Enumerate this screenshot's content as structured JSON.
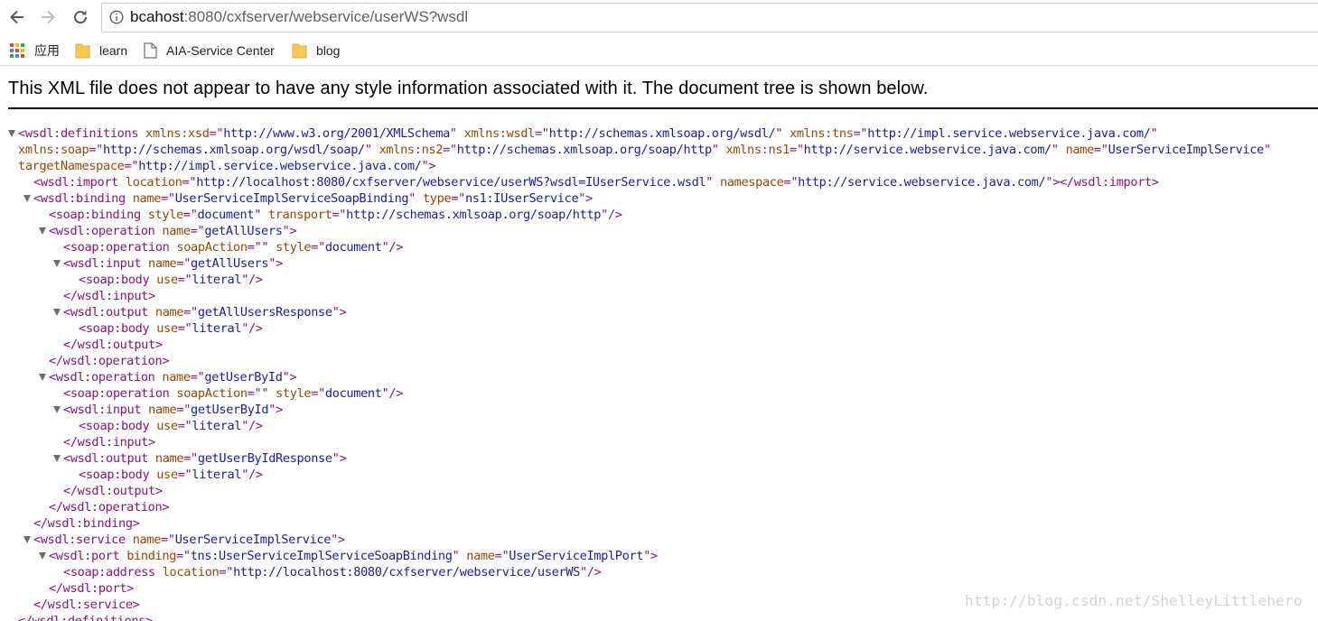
{
  "browser": {
    "url_host": "bcahost",
    "url_rest": ":8080/cxfserver/webservice/userWS?wsdl",
    "bookmarks": [
      {
        "label": "应用",
        "icon": "apps-grid-icon"
      },
      {
        "label": "learn",
        "icon": "folder-icon"
      },
      {
        "label": "AIA-Service Center",
        "icon": "page-icon"
      },
      {
        "label": "blog",
        "icon": "folder-icon"
      }
    ]
  },
  "page": {
    "notice": "This XML file does not appear to have any style information associated with it. The document tree is shown below."
  },
  "xml_lines": [
    {
      "indent": 20,
      "collapsible": true,
      "segs": [
        [
          "tg",
          "<wsdl:definitions"
        ],
        [
          "t",
          " "
        ],
        [
          "an",
          "xmlns:xsd"
        ],
        [
          "tg",
          "=\""
        ],
        [
          "av",
          "http://www.w3.org/2001/XMLSchema"
        ],
        [
          "tg",
          "\""
        ],
        [
          "t",
          " "
        ],
        [
          "an",
          "xmlns:wsdl"
        ],
        [
          "tg",
          "=\""
        ],
        [
          "av",
          "http://schemas.xmlsoap.org/wsdl/"
        ],
        [
          "tg",
          "\""
        ],
        [
          "t",
          " "
        ],
        [
          "an",
          "xmlns:tns"
        ],
        [
          "tg",
          "=\""
        ],
        [
          "av",
          "http://impl.service.webservice.java.com/"
        ],
        [
          "tg",
          "\""
        ]
      ]
    },
    {
      "indent": 20,
      "collapsible": false,
      "segs": [
        [
          "an",
          "xmlns:soap"
        ],
        [
          "tg",
          "=\""
        ],
        [
          "av",
          "http://schemas.xmlsoap.org/wsdl/soap/"
        ],
        [
          "tg",
          "\""
        ],
        [
          "t",
          " "
        ],
        [
          "an",
          "xmlns:ns2"
        ],
        [
          "tg",
          "=\""
        ],
        [
          "av",
          "http://schemas.xmlsoap.org/soap/http"
        ],
        [
          "tg",
          "\""
        ],
        [
          "t",
          " "
        ],
        [
          "an",
          "xmlns:ns1"
        ],
        [
          "tg",
          "=\""
        ],
        [
          "av",
          "http://service.webservice.java.com/"
        ],
        [
          "tg",
          "\""
        ],
        [
          "t",
          " "
        ],
        [
          "an",
          "name"
        ],
        [
          "tg",
          "=\""
        ],
        [
          "av",
          "UserServiceImplService"
        ],
        [
          "tg",
          "\""
        ]
      ]
    },
    {
      "indent": 20,
      "collapsible": false,
      "segs": [
        [
          "an",
          "targetNamespace"
        ],
        [
          "tg",
          "=\""
        ],
        [
          "av",
          "http://impl.service.webservice.java.com/"
        ],
        [
          "tg",
          "\">"
        ]
      ]
    },
    {
      "indent": 37,
      "collapsible": false,
      "segs": [
        [
          "tg",
          "<wsdl:import"
        ],
        [
          "t",
          " "
        ],
        [
          "an",
          "location"
        ],
        [
          "tg",
          "=\""
        ],
        [
          "av",
          "http://localhost:8080/cxfserver/webservice/userWS?wsdl=IUserService.wsdl"
        ],
        [
          "tg",
          "\""
        ],
        [
          "t",
          " "
        ],
        [
          "an",
          "namespace"
        ],
        [
          "tg",
          "=\""
        ],
        [
          "av",
          "http://service.webservice.java.com/"
        ],
        [
          "tg",
          "\"></wsdl:import>"
        ]
      ]
    },
    {
      "indent": 37,
      "collapsible": true,
      "segs": [
        [
          "tg",
          "<wsdl:binding"
        ],
        [
          "t",
          " "
        ],
        [
          "an",
          "name"
        ],
        [
          "tg",
          "=\""
        ],
        [
          "av",
          "UserServiceImplServiceSoapBinding"
        ],
        [
          "tg",
          "\""
        ],
        [
          "t",
          " "
        ],
        [
          "an",
          "type"
        ],
        [
          "tg",
          "=\""
        ],
        [
          "av",
          "ns1:IUserService"
        ],
        [
          "tg",
          "\">"
        ]
      ]
    },
    {
      "indent": 54,
      "collapsible": false,
      "segs": [
        [
          "tg",
          "<soap:binding"
        ],
        [
          "t",
          " "
        ],
        [
          "an",
          "style"
        ],
        [
          "tg",
          "=\""
        ],
        [
          "av",
          "document"
        ],
        [
          "tg",
          "\""
        ],
        [
          "t",
          " "
        ],
        [
          "an",
          "transport"
        ],
        [
          "tg",
          "=\""
        ],
        [
          "av",
          "http://schemas.xmlsoap.org/soap/http"
        ],
        [
          "tg",
          "\"/>"
        ]
      ]
    },
    {
      "indent": 54,
      "collapsible": true,
      "segs": [
        [
          "tg",
          "<wsdl:operation"
        ],
        [
          "t",
          " "
        ],
        [
          "an",
          "name"
        ],
        [
          "tg",
          "=\""
        ],
        [
          "av",
          "getAllUsers"
        ],
        [
          "tg",
          "\">"
        ]
      ]
    },
    {
      "indent": 70,
      "collapsible": false,
      "segs": [
        [
          "tg",
          "<soap:operation"
        ],
        [
          "t",
          " "
        ],
        [
          "an",
          "soapAction"
        ],
        [
          "tg",
          "=\"\""
        ],
        [
          "t",
          " "
        ],
        [
          "an",
          "style"
        ],
        [
          "tg",
          "=\""
        ],
        [
          "av",
          "document"
        ],
        [
          "tg",
          "\"/>"
        ]
      ]
    },
    {
      "indent": 70,
      "collapsible": true,
      "segs": [
        [
          "tg",
          "<wsdl:input"
        ],
        [
          "t",
          " "
        ],
        [
          "an",
          "name"
        ],
        [
          "tg",
          "=\""
        ],
        [
          "av",
          "getAllUsers"
        ],
        [
          "tg",
          "\">"
        ]
      ]
    },
    {
      "indent": 87,
      "collapsible": false,
      "segs": [
        [
          "tg",
          "<soap:body"
        ],
        [
          "t",
          " "
        ],
        [
          "an",
          "use"
        ],
        [
          "tg",
          "=\""
        ],
        [
          "av",
          "literal"
        ],
        [
          "tg",
          "\"/>"
        ]
      ]
    },
    {
      "indent": 70,
      "collapsible": false,
      "segs": [
        [
          "tg",
          "</wsdl:input>"
        ]
      ]
    },
    {
      "indent": 70,
      "collapsible": true,
      "segs": [
        [
          "tg",
          "<wsdl:output"
        ],
        [
          "t",
          " "
        ],
        [
          "an",
          "name"
        ],
        [
          "tg",
          "=\""
        ],
        [
          "av",
          "getAllUsersResponse"
        ],
        [
          "tg",
          "\">"
        ]
      ]
    },
    {
      "indent": 87,
      "collapsible": false,
      "segs": [
        [
          "tg",
          "<soap:body"
        ],
        [
          "t",
          " "
        ],
        [
          "an",
          "use"
        ],
        [
          "tg",
          "=\""
        ],
        [
          "av",
          "literal"
        ],
        [
          "tg",
          "\"/>"
        ]
      ]
    },
    {
      "indent": 70,
      "collapsible": false,
      "segs": [
        [
          "tg",
          "</wsdl:output>"
        ]
      ]
    },
    {
      "indent": 54,
      "collapsible": false,
      "segs": [
        [
          "tg",
          "</wsdl:operation>"
        ]
      ]
    },
    {
      "indent": 54,
      "collapsible": true,
      "segs": [
        [
          "tg",
          "<wsdl:operation"
        ],
        [
          "t",
          " "
        ],
        [
          "an",
          "name"
        ],
        [
          "tg",
          "=\""
        ],
        [
          "av",
          "getUserById"
        ],
        [
          "tg",
          "\">"
        ]
      ]
    },
    {
      "indent": 70,
      "collapsible": false,
      "segs": [
        [
          "tg",
          "<soap:operation"
        ],
        [
          "t",
          " "
        ],
        [
          "an",
          "soapAction"
        ],
        [
          "tg",
          "=\"\""
        ],
        [
          "t",
          " "
        ],
        [
          "an",
          "style"
        ],
        [
          "tg",
          "=\""
        ],
        [
          "av",
          "document"
        ],
        [
          "tg",
          "\"/>"
        ]
      ]
    },
    {
      "indent": 70,
      "collapsible": true,
      "segs": [
        [
          "tg",
          "<wsdl:input"
        ],
        [
          "t",
          " "
        ],
        [
          "an",
          "name"
        ],
        [
          "tg",
          "=\""
        ],
        [
          "av",
          "getUserById"
        ],
        [
          "tg",
          "\">"
        ]
      ]
    },
    {
      "indent": 87,
      "collapsible": false,
      "segs": [
        [
          "tg",
          "<soap:body"
        ],
        [
          "t",
          " "
        ],
        [
          "an",
          "use"
        ],
        [
          "tg",
          "=\""
        ],
        [
          "av",
          "literal"
        ],
        [
          "tg",
          "\"/>"
        ]
      ]
    },
    {
      "indent": 70,
      "collapsible": false,
      "segs": [
        [
          "tg",
          "</wsdl:input>"
        ]
      ]
    },
    {
      "indent": 70,
      "collapsible": true,
      "segs": [
        [
          "tg",
          "<wsdl:output"
        ],
        [
          "t",
          " "
        ],
        [
          "an",
          "name"
        ],
        [
          "tg",
          "=\""
        ],
        [
          "av",
          "getUserByIdResponse"
        ],
        [
          "tg",
          "\">"
        ]
      ]
    },
    {
      "indent": 87,
      "collapsible": false,
      "segs": [
        [
          "tg",
          "<soap:body"
        ],
        [
          "t",
          " "
        ],
        [
          "an",
          "use"
        ],
        [
          "tg",
          "=\""
        ],
        [
          "av",
          "literal"
        ],
        [
          "tg",
          "\"/>"
        ]
      ]
    },
    {
      "indent": 70,
      "collapsible": false,
      "segs": [
        [
          "tg",
          "</wsdl:output>"
        ]
      ]
    },
    {
      "indent": 54,
      "collapsible": false,
      "segs": [
        [
          "tg",
          "</wsdl:operation>"
        ]
      ]
    },
    {
      "indent": 37,
      "collapsible": false,
      "segs": [
        [
          "tg",
          "</wsdl:binding>"
        ]
      ]
    },
    {
      "indent": 37,
      "collapsible": true,
      "segs": [
        [
          "tg",
          "<wsdl:service"
        ],
        [
          "t",
          " "
        ],
        [
          "an",
          "name"
        ],
        [
          "tg",
          "=\""
        ],
        [
          "av",
          "UserServiceImplService"
        ],
        [
          "tg",
          "\">"
        ]
      ]
    },
    {
      "indent": 54,
      "collapsible": true,
      "segs": [
        [
          "tg",
          "<wsdl:port"
        ],
        [
          "t",
          " "
        ],
        [
          "an",
          "binding"
        ],
        [
          "tg",
          "=\""
        ],
        [
          "av",
          "tns:UserServiceImplServiceSoapBinding"
        ],
        [
          "tg",
          "\""
        ],
        [
          "t",
          " "
        ],
        [
          "an",
          "name"
        ],
        [
          "tg",
          "=\""
        ],
        [
          "av",
          "UserServiceImplPort"
        ],
        [
          "tg",
          "\">"
        ]
      ]
    },
    {
      "indent": 70,
      "collapsible": false,
      "segs": [
        [
          "tg",
          "<soap:address"
        ],
        [
          "t",
          " "
        ],
        [
          "an",
          "location"
        ],
        [
          "tg",
          "=\""
        ],
        [
          "av",
          "http://localhost:8080/cxfserver/webservice/userWS"
        ],
        [
          "tg",
          "\"/>"
        ]
      ]
    },
    {
      "indent": 54,
      "collapsible": false,
      "segs": [
        [
          "tg",
          "</wsdl:port>"
        ]
      ]
    },
    {
      "indent": 37,
      "collapsible": false,
      "segs": [
        [
          "tg",
          "</wsdl:service>"
        ]
      ]
    },
    {
      "indent": 20,
      "collapsible": false,
      "segs": [
        [
          "tg",
          "</wsdl:definitions>"
        ]
      ]
    }
  ],
  "watermark": "http://blog.csdn.net/ShelleyLittlehero"
}
